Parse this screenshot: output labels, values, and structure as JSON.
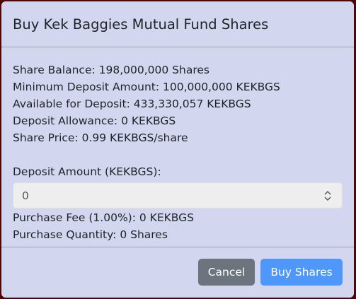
{
  "modal": {
    "title": "Buy Kek Baggies Mutual Fund Shares",
    "info": {
      "share_balance": "Share Balance: 198,000,000 Shares",
      "min_deposit": "Minimum Deposit Amount: 100,000,000 KEKBGS",
      "available": "Available for Deposit: 433,330,057 KEKBGS",
      "allowance": "Deposit Allowance: 0 KEKBGS",
      "share_price": "Share Price: 0.99 KEKBGS/share"
    },
    "deposit": {
      "label": "Deposit Amount (KEKBGS):",
      "value": "0"
    },
    "summary": {
      "fee": "Purchase Fee (1.00%): 0 KEKBGS",
      "quantity": "Purchase Quantity: 0 Shares"
    },
    "buttons": {
      "cancel": "Cancel",
      "buy": "Buy Shares"
    }
  },
  "colors": {
    "modal_bg": "#d3d6ef",
    "cancel_button": "#6c757d",
    "buy_button": "#4f97f9"
  },
  "icons": {
    "spinner": "up-down-stepper-icon"
  }
}
